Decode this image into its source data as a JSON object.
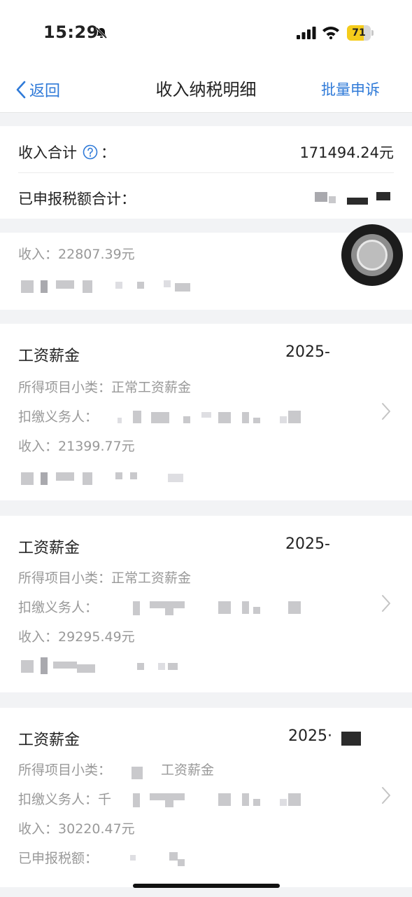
{
  "status_bar": {
    "time": "15:29",
    "battery_level": "71",
    "battery_fraction": 0.71
  },
  "nav": {
    "back_label": "返回",
    "title": "收入纳税明细",
    "action_label": "批量申诉"
  },
  "summary": {
    "income_total_label": "收入合计",
    "income_total_colon": "：",
    "income_total_value": "171494.24元",
    "tax_total_label": "已申报税额合计："
  },
  "cards": [
    {
      "income_label": "收入：",
      "income_value": "22807.39元"
    },
    {
      "title": "工资薪金",
      "date": "2025-",
      "subcategory_label": "所得项目小类：",
      "subcategory_value": "正常工资薪金",
      "withholder_label": "扣缴义务人：",
      "income_label": "收入：",
      "income_value": "21399.77元"
    },
    {
      "title": "工资薪金",
      "date": "2025-",
      "subcategory_label": "所得项目小类：",
      "subcategory_value": "正常工资薪金",
      "withholder_label": "扣缴义务人：",
      "income_label": "收入：",
      "income_value": "29295.49元"
    },
    {
      "title": "工资薪金",
      "date": "2025·",
      "subcategory_label": "所得项目小类：",
      "subcategory_value": "工资薪金",
      "withholder_label": "扣缴义务人：千",
      "income_label": "收入：",
      "income_value": "30220.47元",
      "declared_tax_label": "已申报税额："
    }
  ],
  "colors": {
    "accent": "#2f7ad8",
    "background": "#f2f3f5",
    "battery": "#f5cc1b",
    "muted_text": "#999999"
  },
  "icons": [
    "bell-slash-icon",
    "signal-icon",
    "wifi-icon",
    "battery-icon",
    "back-chevron-icon",
    "help-icon",
    "chevron-right-icon"
  ]
}
